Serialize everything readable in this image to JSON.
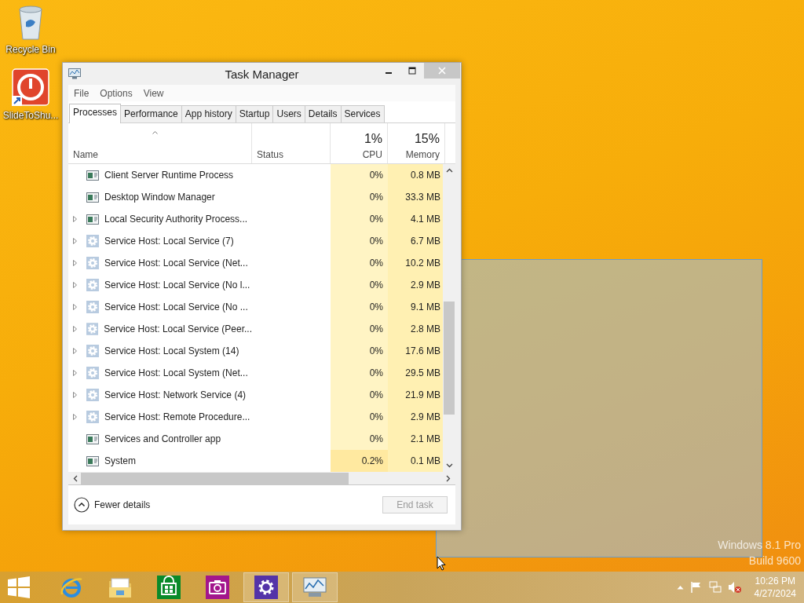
{
  "desktop_icons": [
    {
      "kind": "recycle",
      "label": "Recycle Bin"
    },
    {
      "kind": "power",
      "label": "SlideToShu..."
    }
  ],
  "window": {
    "title": "Task Manager",
    "menu": [
      "File",
      "Options",
      "View"
    ],
    "tabs": [
      {
        "label": "Processes",
        "selected": true
      },
      {
        "label": "Performance",
        "selected": false
      },
      {
        "label": "App history",
        "selected": false
      },
      {
        "label": "Startup",
        "selected": false
      },
      {
        "label": "Users",
        "selected": false
      },
      {
        "label": "Details",
        "selected": false
      },
      {
        "label": "Services",
        "selected": false
      }
    ],
    "columns": {
      "name": "Name",
      "status": "Status",
      "cpu_total": "1%",
      "cpu": "CPU",
      "memory_total": "15%",
      "memory": "Memory"
    },
    "rows": [
      {
        "kind": "app",
        "expandable": false,
        "name": "Client Server Runtime Process",
        "cpu": "0%",
        "memory": "0.8 MB",
        "cpu_busy": false
      },
      {
        "kind": "app",
        "expandable": false,
        "name": "Desktop Window Manager",
        "cpu": "0%",
        "memory": "33.3 MB",
        "cpu_busy": false
      },
      {
        "kind": "app",
        "expandable": true,
        "name": "Local Security Authority Process...",
        "cpu": "0%",
        "memory": "4.1 MB",
        "cpu_busy": false
      },
      {
        "kind": "service",
        "expandable": true,
        "name": "Service Host: Local Service (7)",
        "cpu": "0%",
        "memory": "6.7 MB",
        "cpu_busy": false
      },
      {
        "kind": "service",
        "expandable": true,
        "name": "Service Host: Local Service (Net...",
        "cpu": "0%",
        "memory": "10.2 MB",
        "cpu_busy": false
      },
      {
        "kind": "service",
        "expandable": true,
        "name": "Service Host: Local Service (No l...",
        "cpu": "0%",
        "memory": "2.9 MB",
        "cpu_busy": false
      },
      {
        "kind": "service",
        "expandable": true,
        "name": "Service Host: Local Service (No ...",
        "cpu": "0%",
        "memory": "9.1 MB",
        "cpu_busy": false
      },
      {
        "kind": "service",
        "expandable": true,
        "name": "Service Host: Local Service (Peer...",
        "cpu": "0%",
        "memory": "2.8 MB",
        "cpu_busy": false
      },
      {
        "kind": "service",
        "expandable": true,
        "name": "Service Host: Local System (14)",
        "cpu": "0%",
        "memory": "17.6 MB",
        "cpu_busy": false
      },
      {
        "kind": "service",
        "expandable": true,
        "name": "Service Host: Local System (Net...",
        "cpu": "0%",
        "memory": "29.5 MB",
        "cpu_busy": false
      },
      {
        "kind": "service",
        "expandable": true,
        "name": "Service Host: Network Service (4)",
        "cpu": "0%",
        "memory": "21.9 MB",
        "cpu_busy": false
      },
      {
        "kind": "service",
        "expandable": true,
        "name": "Service Host: Remote Procedure...",
        "cpu": "0%",
        "memory": "2.9 MB",
        "cpu_busy": false
      },
      {
        "kind": "app",
        "expandable": false,
        "name": "Services and Controller app",
        "cpu": "0%",
        "memory": "2.1 MB",
        "cpu_busy": false
      },
      {
        "kind": "app",
        "expandable": false,
        "name": "System",
        "cpu": "0.2%",
        "memory": "0.1 MB",
        "cpu_busy": true
      }
    ],
    "fewer_details": "Fewer details",
    "end_task": {
      "label": "End task",
      "disabled": true
    }
  },
  "watermark": [
    "Windows 8.1 Pro",
    "Build 9600"
  ],
  "taskbar": {
    "apps": [
      {
        "kind": "ie",
        "active": false
      },
      {
        "kind": "explorer",
        "active": false
      },
      {
        "kind": "store",
        "active": false
      },
      {
        "kind": "camera",
        "active": false
      },
      {
        "kind": "settings",
        "active": true
      },
      {
        "kind": "taskmgr",
        "active": true
      }
    ],
    "time": "10:26 PM",
    "date": "4/27/2024"
  }
}
